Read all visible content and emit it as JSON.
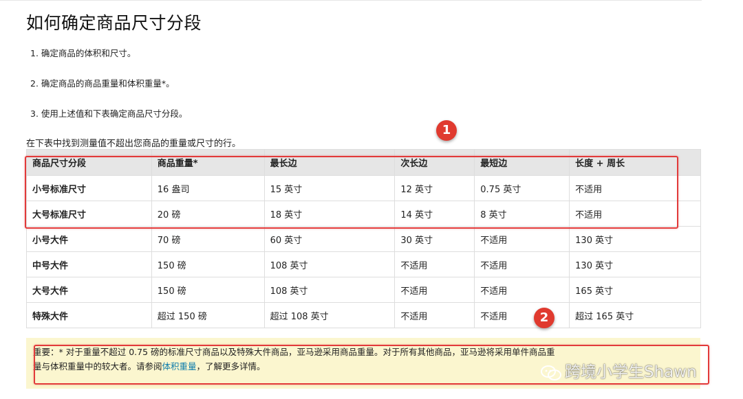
{
  "title": "如何确定商品尺寸分段",
  "steps": [
    "1. 确定商品的体积和尺寸。",
    "2. 确定商品的商品重量和体积重量*。",
    "3. 使用上述值和下表确定商品尺寸分段。"
  ],
  "intro": "在下表中找到测量值不超出您商品的重量或尺寸的行。",
  "table": {
    "headers": [
      "商品尺寸分段",
      "商品重量*",
      "最长边",
      "次长边",
      "最短边",
      "长度 + 周长"
    ],
    "rows": [
      [
        "小号标准尺寸",
        "16 盎司",
        "15 英寸",
        "12 英寸",
        "0.75 英寸",
        "不适用"
      ],
      [
        "大号标准尺寸",
        "20 磅",
        "18 英寸",
        "14 英寸",
        "8 英寸",
        "不适用"
      ],
      [
        "小号大件",
        "70 磅",
        "60 英寸",
        "30 英寸",
        "不适用",
        "130 英寸"
      ],
      [
        "中号大件",
        "150 磅",
        "108 英寸",
        "不适用",
        "不适用",
        "130 英寸"
      ],
      [
        "大号大件",
        "150 磅",
        "108 英寸",
        "不适用",
        "不适用",
        "165 英寸"
      ],
      [
        "特殊大件",
        "超过 150 磅",
        "超过 108 英寸",
        "不适用",
        "不适用",
        "超过 165 英寸"
      ]
    ]
  },
  "badges": [
    "1",
    "2"
  ],
  "notice": {
    "lead": "重要：",
    "text1": "* 对于重量不超过 0.75 磅的标准尺寸商品以及特殊大件商品，亚马逊采用商品重量。对于所有其他商品，亚马逊将采用单件商品重量与体积重量中的较大者。请参阅",
    "link": "体积重量",
    "text2": "，了解更多详情。"
  },
  "watermark": "跨境小学生Shawn",
  "colors": {
    "highlight": "#e23a3a",
    "badge": "#e03a2f",
    "notice_bg": "#fbf6cf",
    "link": "#0e7cab",
    "header_bg": "#e6e6e6"
  }
}
